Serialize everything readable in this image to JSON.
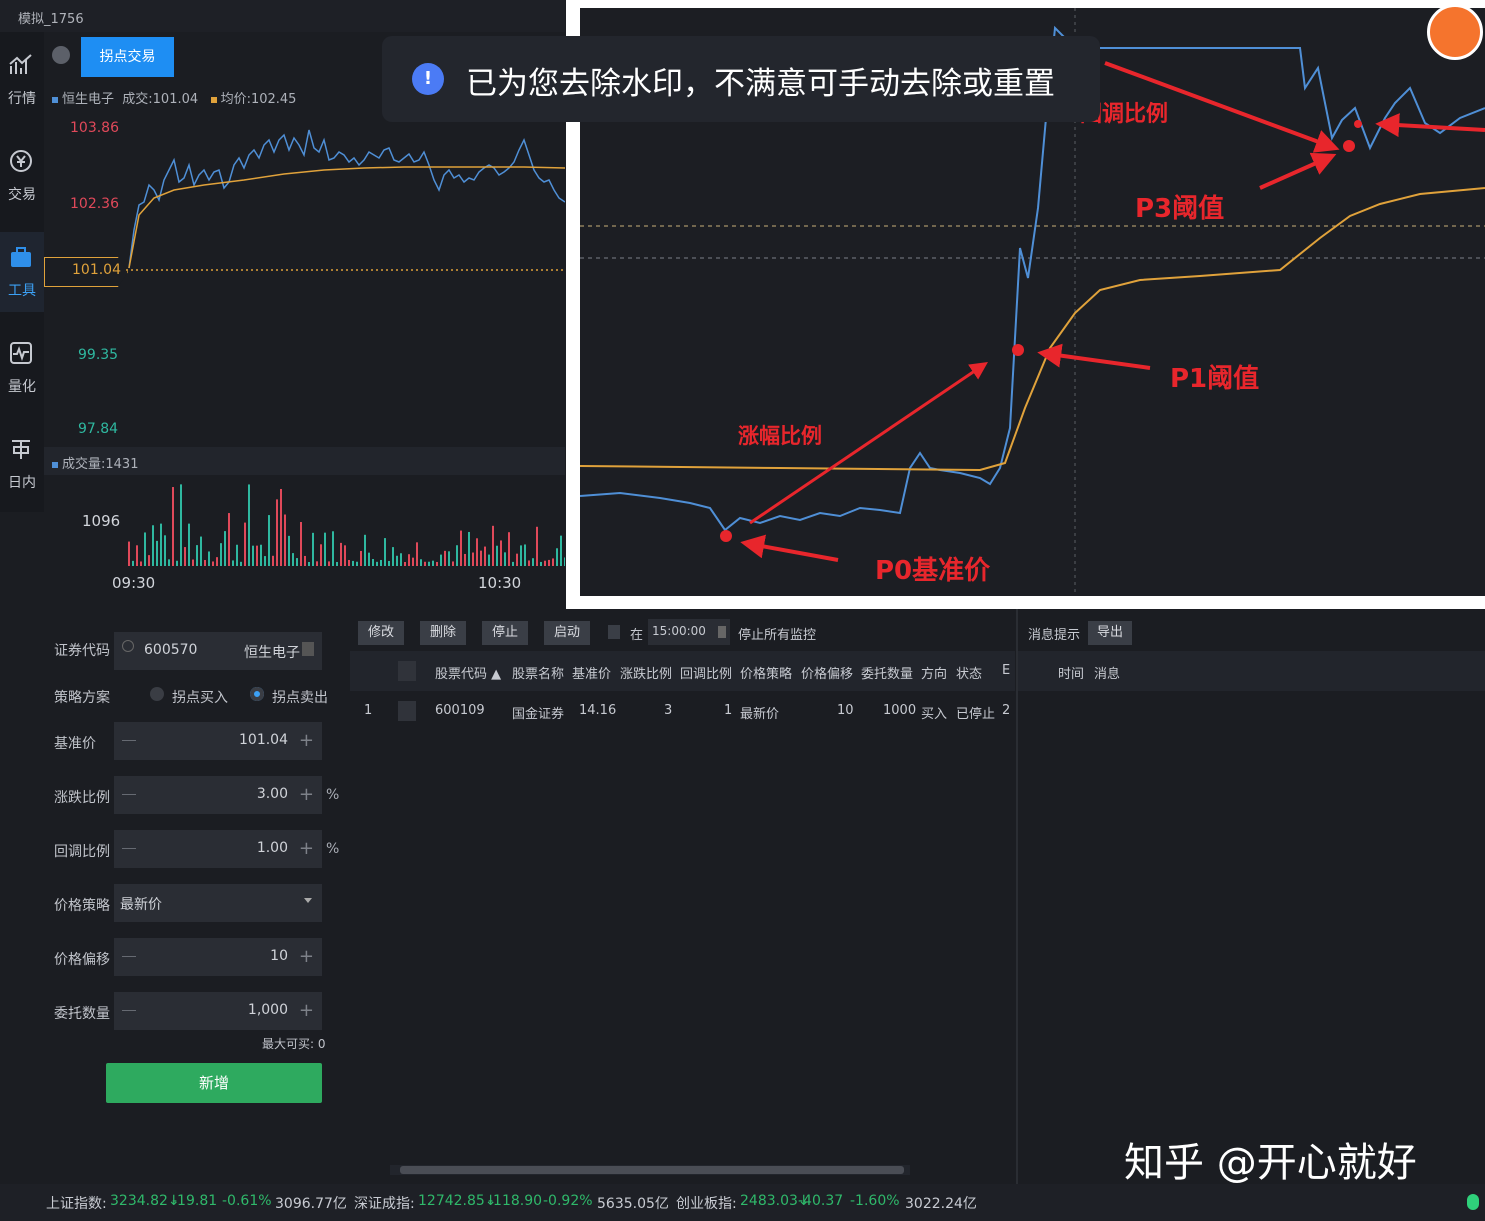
{
  "window": {
    "title": "模拟_1756"
  },
  "sidebar": {
    "items": [
      {
        "label": "行情",
        "icon": "chart-icon"
      },
      {
        "label": "交易",
        "icon": "yen-icon"
      },
      {
        "label": "工具",
        "icon": "briefcase-icon"
      },
      {
        "label": "量化",
        "icon": "pulse-icon"
      },
      {
        "label": "日内",
        "icon": "t-icon"
      }
    ]
  },
  "tabs": {
    "active": "拐点交易"
  },
  "legend": {
    "name": "恒生电子",
    "deal": "成交:101.04",
    "avg": "均价:102.45"
  },
  "price_axis": {
    "labels": [
      "103.86",
      "102.36",
      "101.04",
      "99.35",
      "97.84"
    ]
  },
  "volume": {
    "legend": "成交量:1431",
    "axis_label": "1096",
    "times": [
      "09:30",
      "10:30"
    ]
  },
  "colors": {
    "price_line": "#4f8fd6",
    "avg_line": "#e0a23b",
    "up": "#e0495a",
    "down": "#2fb8a0",
    "arrow": "#e8262c",
    "button": "#2eaa5f"
  },
  "toast": {
    "text": "已为您去除水印，不满意可手动去除或重置"
  },
  "inset": {
    "labels": {
      "callback": "回调比例",
      "p3": "P3阈值",
      "p1": "P1阈值",
      "rise": "涨幅比例",
      "p0": "P0基准价"
    }
  },
  "form": {
    "code_label": "证券代码",
    "code_value": "600570",
    "code_name": "恒生电子",
    "strategy_label": "策略方案",
    "option_buy": "拐点买入",
    "option_sell": "拐点卖出",
    "base_label": "基准价",
    "base_value": "101.04",
    "rise_label": "涨跌比例",
    "rise_value": "3.00",
    "callback_label": "回调比例",
    "callback_value": "1.00",
    "pct": "%",
    "price_strategy_label": "价格策略",
    "price_strategy_value": "最新价",
    "offset_label": "价格偏移",
    "offset_value": "10",
    "qty_label": "委托数量",
    "qty_value": "1,000",
    "max_label": "最大可买: 0",
    "submit": "新增"
  },
  "toolbar": {
    "modify": "修改",
    "delete": "删除",
    "stop": "停止",
    "start": "启动",
    "time_prefix": "在",
    "time_value": "15:00:00",
    "stop_all": "停止所有监控"
  },
  "table": {
    "headers": [
      "股票代码 ▲",
      "股票名称",
      "基准价",
      "涨跌比例",
      "回调比例",
      "价格策略",
      "价格偏移",
      "委托数量",
      "方向",
      "状态",
      "E"
    ],
    "rows": [
      [
        "1",
        "600109",
        "国金证券",
        "14.16",
        "3",
        "1",
        "最新价",
        "10",
        "1000",
        "买入",
        "已停止",
        "2"
      ]
    ]
  },
  "messages": {
    "title": "消息提示",
    "export": "导出",
    "col_time": "时间",
    "col_msg": "消息"
  },
  "status": {
    "sh_label": "上证指数:",
    "sh_value": "3234.82↓",
    "sh_change": "-19.81",
    "sh_pct": "-0.61%",
    "sh_amount": "3096.77亿",
    "sz_label": "深证成指:",
    "sz_value": "12742.85↓",
    "sz_change": "-118.90",
    "sz_pct": "-0.92%",
    "sz_amount": "5635.05亿",
    "cy_label": "创业板指:",
    "cy_value": "2483.03↓",
    "cy_change": "-40.37",
    "cy_pct": "-1.60%",
    "cy_amount": "3022.24亿"
  },
  "watermark": "知乎 @开心就好"
}
